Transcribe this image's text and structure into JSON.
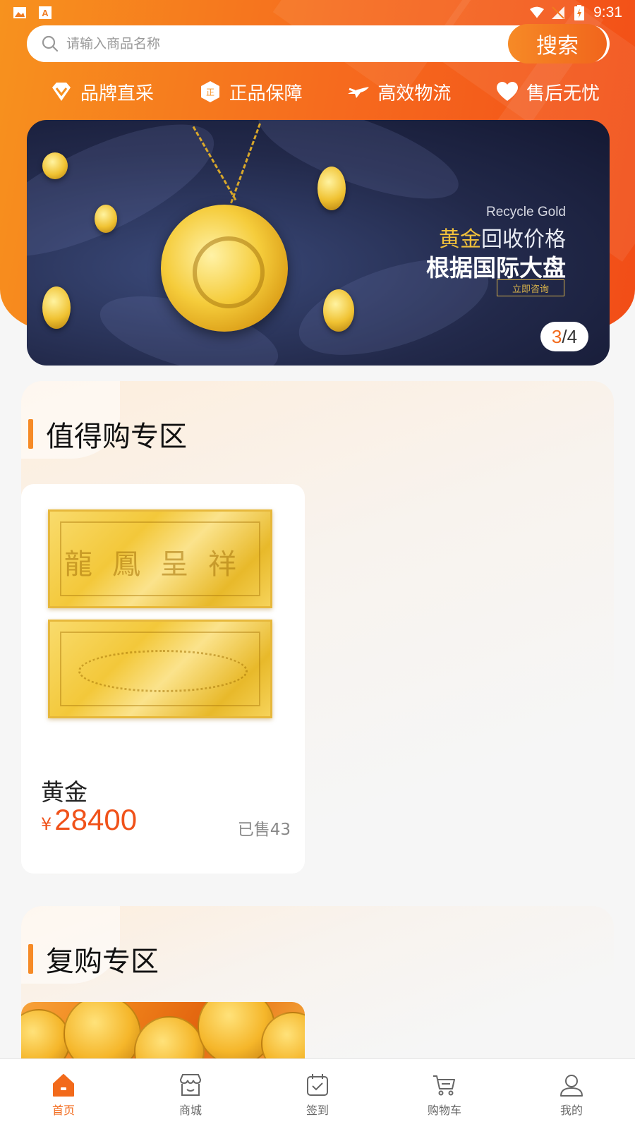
{
  "status_bar": {
    "time": "9:31"
  },
  "search": {
    "placeholder": "请输入商品名称",
    "value": "",
    "button_label": "搜索"
  },
  "features": [
    {
      "label": "品牌直采",
      "icon": "diamond-icon"
    },
    {
      "label": "正品保障",
      "icon": "genuine-badge-icon"
    },
    {
      "label": "高效物流",
      "icon": "airplane-icon"
    },
    {
      "label": "售后无忧",
      "icon": "heart-icon"
    }
  ],
  "banner": {
    "title_en": "Recycle Gold",
    "title_gold": "黄金",
    "title_rest": "回收价格",
    "subtitle": "根据国际大盘",
    "cta": "立即咨询",
    "current_index": "3",
    "separator": "/",
    "total": "4"
  },
  "sections": [
    {
      "title": "值得购专区",
      "products": [
        {
          "name": "黄金",
          "currency": "¥",
          "price": "28400",
          "sold": "已售43",
          "engraving": "龍鳳呈祥"
        }
      ]
    },
    {
      "title": "复购专区"
    }
  ],
  "tabbar": {
    "active": 0,
    "items": [
      {
        "label": "首页",
        "icon": "home-icon"
      },
      {
        "label": "商城",
        "icon": "store-icon"
      },
      {
        "label": "签到",
        "icon": "checkin-calendar-icon"
      },
      {
        "label": "购物车",
        "icon": "cart-icon"
      },
      {
        "label": "我的",
        "icon": "user-icon"
      }
    ]
  },
  "colors": {
    "accent": "#f26a1b",
    "price": "#f0521a",
    "header_start": "#f7921e",
    "header_end": "#f24d17"
  }
}
